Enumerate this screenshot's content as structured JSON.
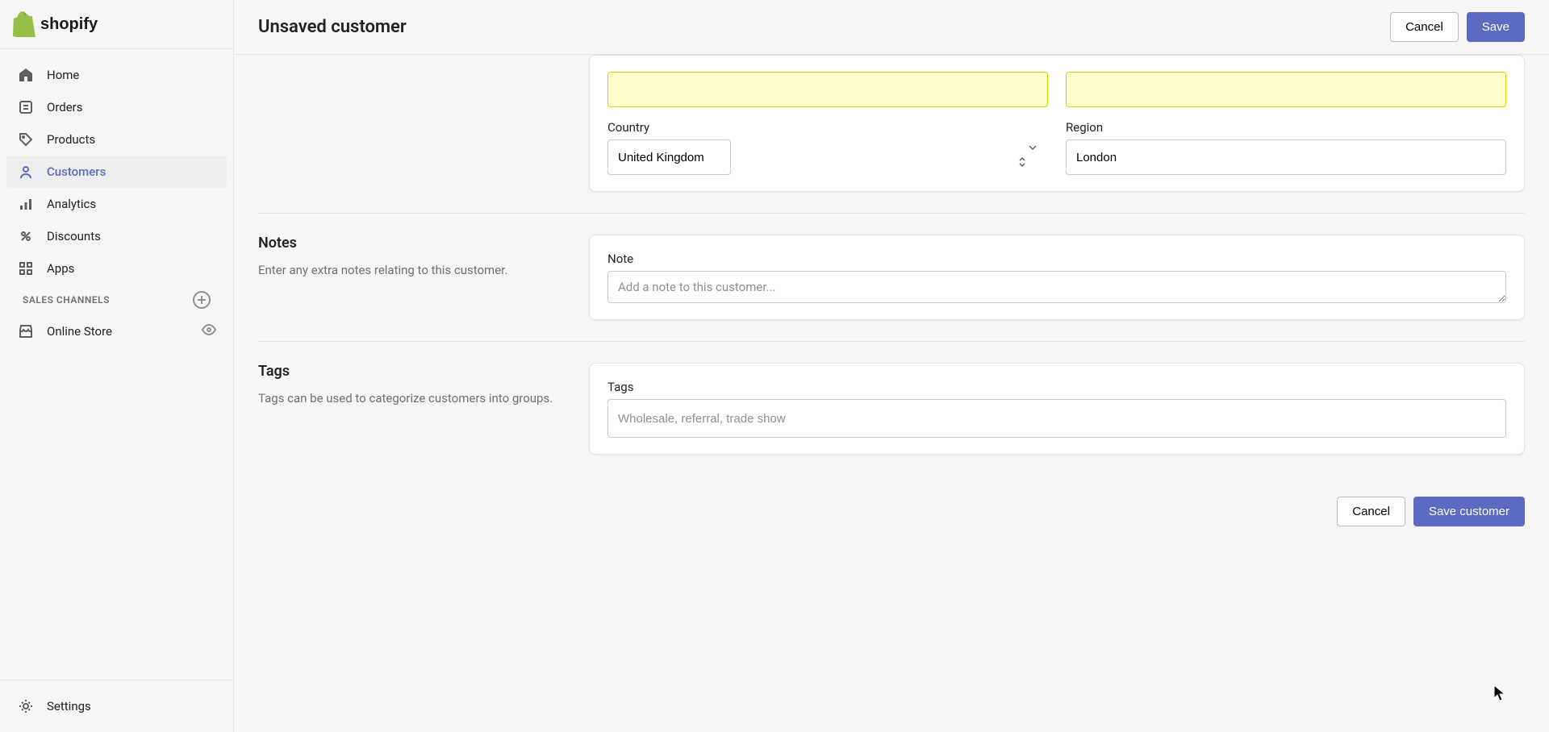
{
  "header": {
    "title": "Unsaved customer",
    "cancel_label": "Cancel",
    "save_label": "Save"
  },
  "sidebar": {
    "items": [
      {
        "label": "Home"
      },
      {
        "label": "Orders"
      },
      {
        "label": "Products"
      },
      {
        "label": "Customers"
      },
      {
        "label": "Analytics"
      },
      {
        "label": "Discounts"
      },
      {
        "label": "Apps"
      }
    ],
    "sales_channels_label": "SALES CHANNELS",
    "online_store_label": "Online Store",
    "settings_label": "Settings"
  },
  "address": {
    "field1_value": "",
    "field2_value": "",
    "country_label": "Country",
    "country_value": "United Kingdom",
    "region_label": "Region",
    "region_value": "London"
  },
  "notes": {
    "heading": "Notes",
    "description": "Enter any extra notes relating to this customer.",
    "note_label": "Note",
    "note_placeholder": "Add a note to this customer..."
  },
  "tags": {
    "heading": "Tags",
    "description": "Tags can be used to categorize customers into groups.",
    "tags_label": "Tags",
    "tags_placeholder": "Wholesale, referral, trade show"
  },
  "footer": {
    "cancel_label": "Cancel",
    "save_label": "Save customer"
  }
}
